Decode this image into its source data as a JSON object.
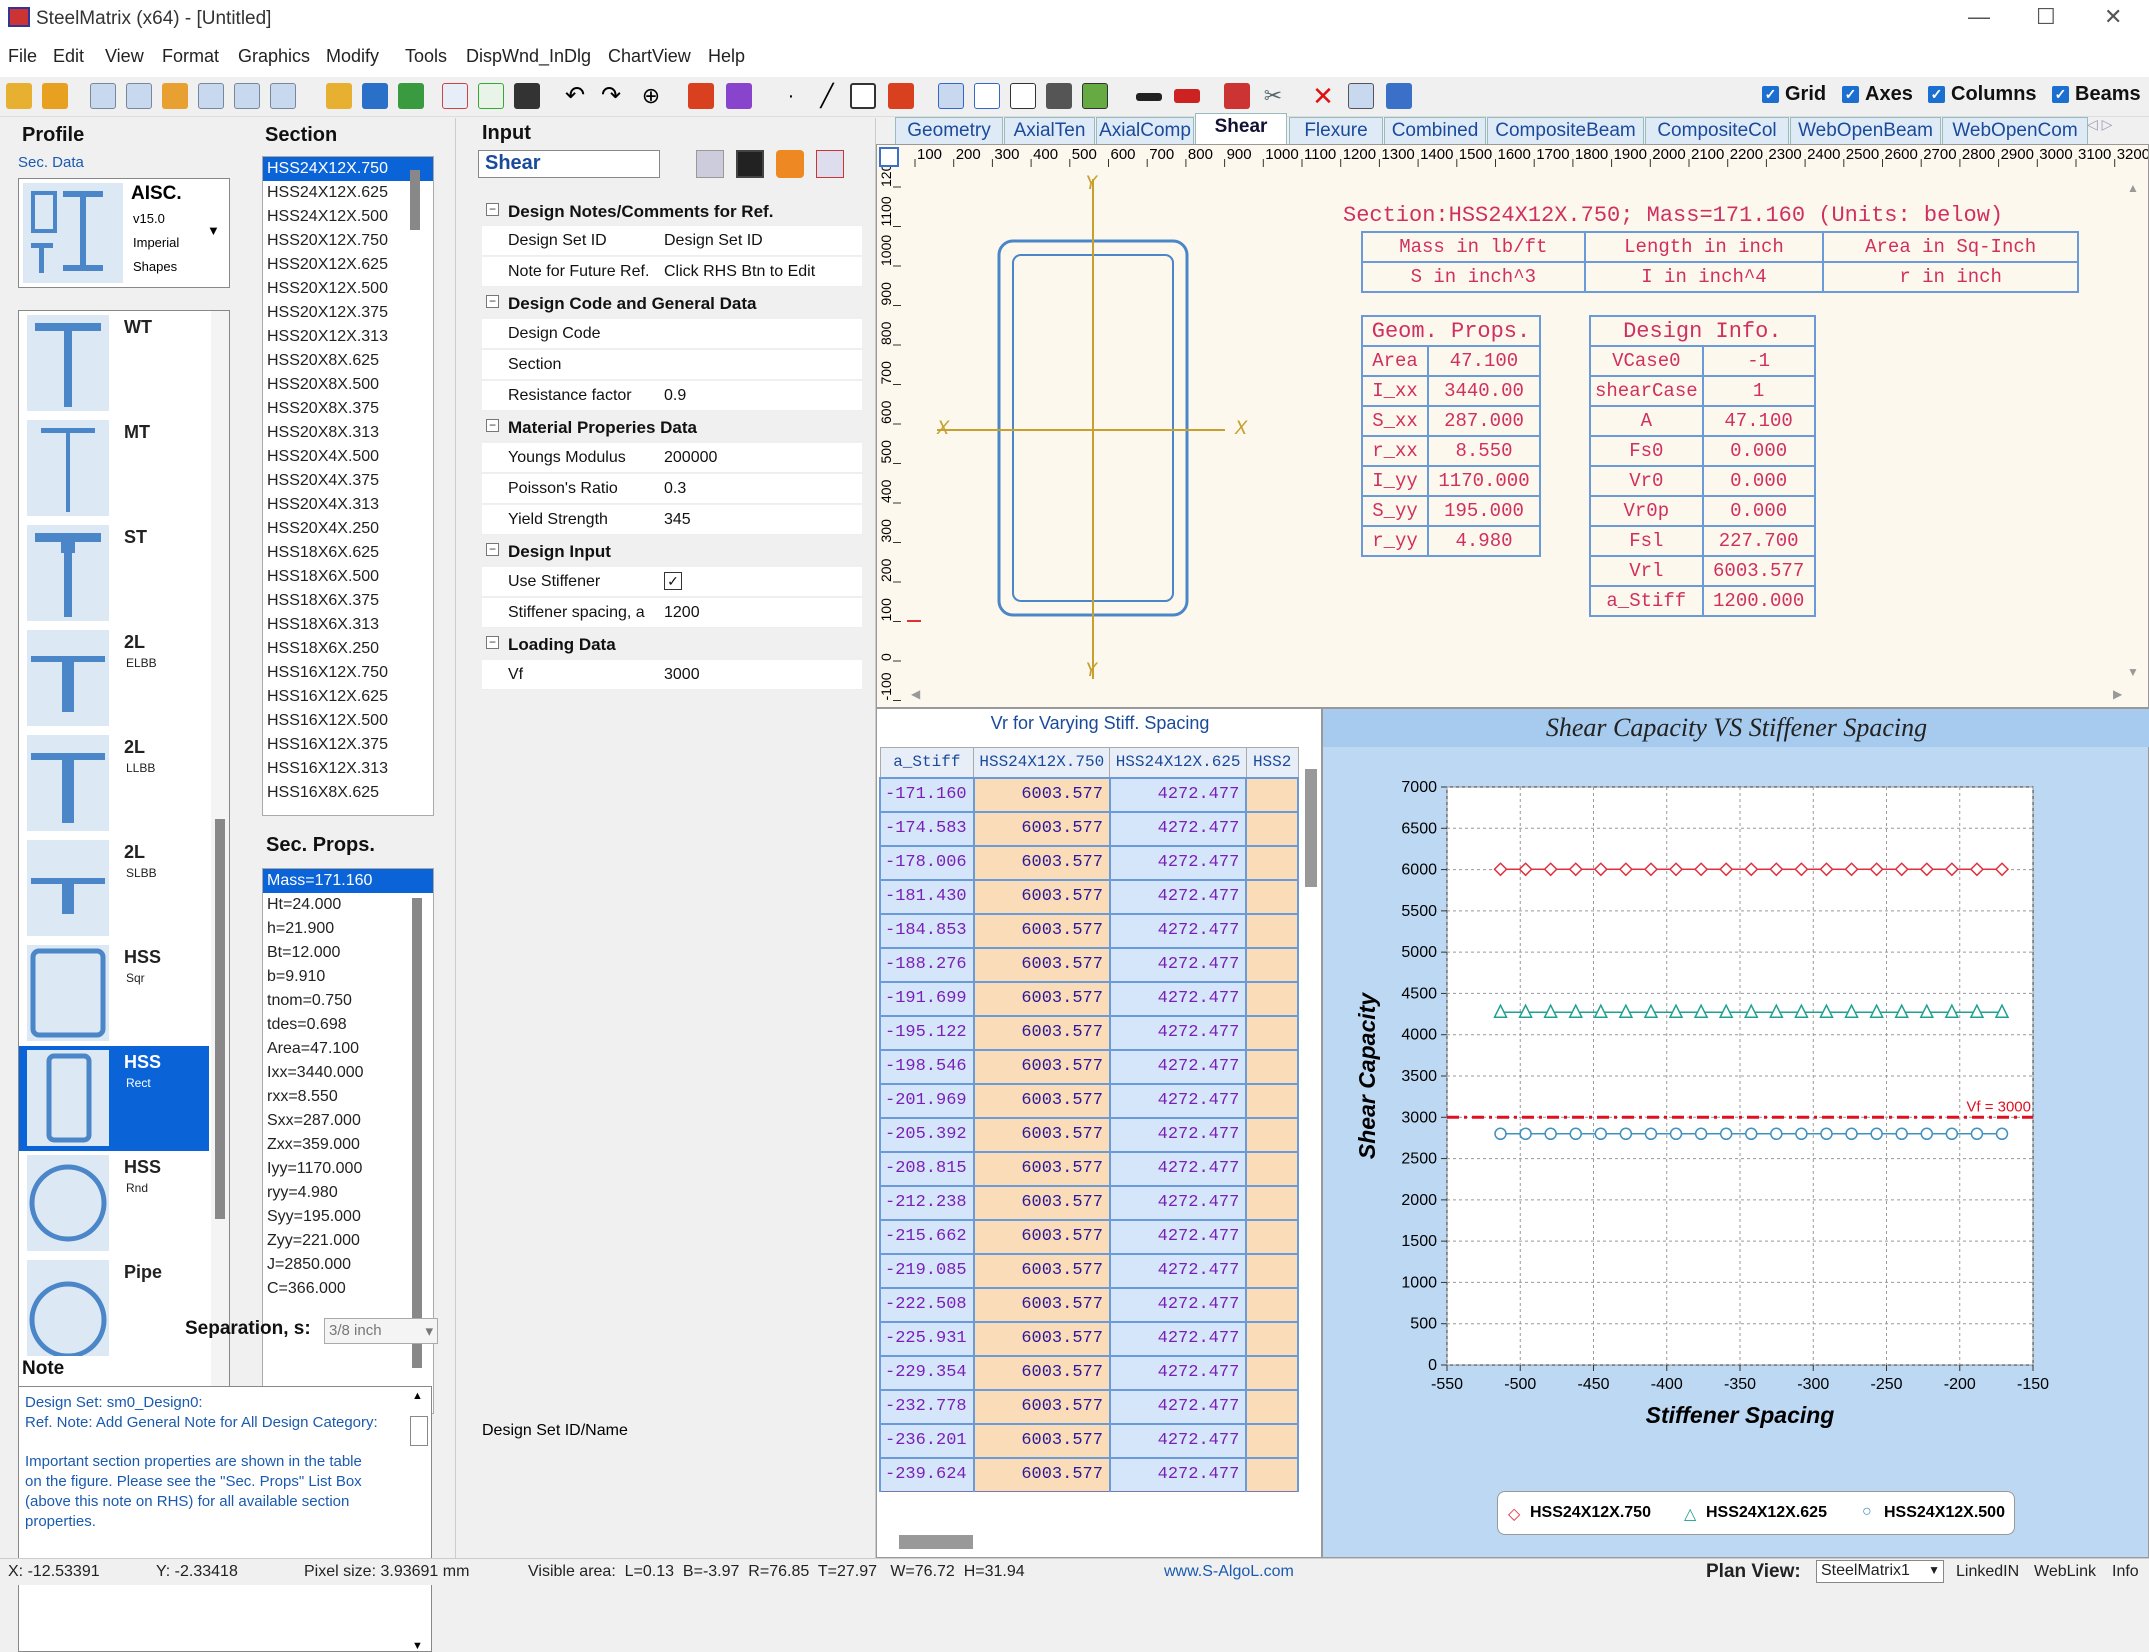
{
  "window": {
    "title": "SteelMatrix (x64) - [Untitled]"
  },
  "menu": [
    "File",
    "Edit",
    "View",
    "Format",
    "Graphics",
    "Modify",
    "Tools",
    "DispWnd_InDlg",
    "ChartView",
    "Help"
  ],
  "view_toggles": [
    {
      "label": "Grid",
      "checked": true
    },
    {
      "label": "Axes",
      "checked": true
    },
    {
      "label": "Columns",
      "checked": true
    },
    {
      "label": "Beams",
      "checked": true
    }
  ],
  "profile": {
    "title": "Profile",
    "sec_data": "Sec. Data",
    "db": {
      "name": "AISC.",
      "ver": "v15.0",
      "units": "Imperial",
      "desc": "Shapes"
    },
    "items": [
      {
        "name": "WT",
        "sub": ""
      },
      {
        "name": "MT",
        "sub": ""
      },
      {
        "name": "ST",
        "sub": ""
      },
      {
        "name": "2L",
        "sub": "ELBB"
      },
      {
        "name": "2L",
        "sub": "LLBB"
      },
      {
        "name": "2L",
        "sub": "SLBB"
      },
      {
        "name": "HSS",
        "sub": "Sqr"
      },
      {
        "name": "HSS",
        "sub": "Rect"
      },
      {
        "name": "HSS",
        "sub": "Rnd"
      },
      {
        "name": "Pipe",
        "sub": ""
      }
    ],
    "selected_index": 7
  },
  "section": {
    "title": "Section",
    "items": [
      "HSS24X12X.750",
      "HSS24X12X.625",
      "HSS24X12X.500",
      "HSS20X12X.750",
      "HSS20X12X.625",
      "HSS20X12X.500",
      "HSS20X12X.375",
      "HSS20X12X.313",
      "HSS20X8X.625",
      "HSS20X8X.500",
      "HSS20X8X.375",
      "HSS20X8X.313",
      "HSS20X4X.500",
      "HSS20X4X.375",
      "HSS20X4X.313",
      "HSS20X4X.250",
      "HSS18X6X.625",
      "HSS18X6X.500",
      "HSS18X6X.375",
      "HSS18X6X.313",
      "HSS18X6X.250",
      "HSS16X12X.750",
      "HSS16X12X.625",
      "HSS16X12X.500",
      "HSS16X12X.375",
      "HSS16X12X.313",
      "HSS16X8X.625"
    ],
    "selected_index": 0
  },
  "sec_props": {
    "title": "Sec. Props.",
    "items": [
      "Mass=171.160",
      "Ht=24.000",
      "h=21.900",
      "Bt=12.000",
      "b=9.910",
      "tnom=0.750",
      "tdes=0.698",
      "Area=47.100",
      "Ixx=3440.000",
      "rxx=8.550",
      "Sxx=287.000",
      "Zxx=359.000",
      "Iyy=1170.000",
      "ryy=4.980",
      "Syy=195.000",
      "Zyy=221.000",
      "J=2850.000",
      "C=366.000"
    ],
    "selected_index": 0
  },
  "separation": {
    "label": "Separation, s:",
    "value": "3/8 inch"
  },
  "note": {
    "title": "Note",
    "lines": [
      "Design Set: sm0_Design0:",
      "Ref. Note: Add General Note for All Design Category:",
      "",
      "Important section properties are shown in the table",
      "on the figure. Please see the \"Sec. Props\" List Box",
      "(above this note on RHS) for all available section",
      "properties."
    ]
  },
  "input": {
    "title": "Input",
    "category": "Shear",
    "rows": [
      {
        "type": "cat",
        "label": "Design Notes/Comments for Ref."
      },
      {
        "type": "row",
        "label": "Design Set ID",
        "value": "Design Set ID"
      },
      {
        "type": "row",
        "label": "Note for Future Ref.",
        "value": "Click RHS Btn to Edit"
      },
      {
        "type": "cat",
        "label": "Design Code and General Data"
      },
      {
        "type": "row",
        "label": "Design Code",
        "value": ""
      },
      {
        "type": "row",
        "label": "Section",
        "value": ""
      },
      {
        "type": "row",
        "label": "Resistance factor",
        "value": "0.9"
      },
      {
        "type": "cat",
        "label": "Material Properies Data"
      },
      {
        "type": "row",
        "label": "Youngs Modulus",
        "value": "200000"
      },
      {
        "type": "row",
        "label": "Poisson's Ratio",
        "value": "0.3"
      },
      {
        "type": "row",
        "label": "Yield Strength",
        "value": "345"
      },
      {
        "type": "cat",
        "label": "Design Input"
      },
      {
        "type": "row",
        "label": "Use Stiffener",
        "value": "✓"
      },
      {
        "type": "row",
        "label": "Stiffener spacing, a",
        "value": "1200"
      },
      {
        "type": "cat",
        "label": "Loading Data"
      },
      {
        "type": "row",
        "label": "Vf",
        "value": "3000"
      }
    ],
    "footer": "Design Set ID/Name"
  },
  "tabs": [
    "Geometry",
    "AxialTen",
    "AxialComp",
    "Shear",
    "Flexure",
    "Combined",
    "CompositeBeam",
    "CompositeCol",
    "WebOpenBeam",
    "WebOpenCom"
  ],
  "active_tab": "Shear",
  "ruler": {
    "x": [
      "100",
      "200",
      "300",
      "400",
      "500",
      "600",
      "700",
      "800",
      "900",
      "1000",
      "1100",
      "1200",
      "1300",
      "1400",
      "1500",
      "1600",
      "1700",
      "1800",
      "1900",
      "2000",
      "2100",
      "2200",
      "2300",
      "2400",
      "2500",
      "2600",
      "2700",
      "2800",
      "2900",
      "3000",
      "3100",
      "3200",
      "330"
    ],
    "y": [
      "1200",
      "1100",
      "1000",
      "900",
      "800",
      "700",
      "600",
      "500",
      "400",
      "300",
      "200",
      "100",
      "0",
      "-100"
    ]
  },
  "drawing": {
    "axis_labels": {
      "y_top": "Y",
      "y_bottom": "Y",
      "x_left": "X",
      "x_right": "X"
    },
    "header": "Section:HSS24X12X.750; Mass=171.160 (Units: below)",
    "units": [
      [
        "Mass in lb/ft",
        "Length in inch",
        "Area in Sq-Inch"
      ],
      [
        "S in inch^3",
        "I in inch^4",
        "r in inch"
      ]
    ],
    "geom_title": "Geom. Props.",
    "geom": [
      [
        "Area",
        "47.100"
      ],
      [
        "I_xx",
        "3440.00"
      ],
      [
        "S_xx",
        "287.000"
      ],
      [
        "r_xx",
        "8.550"
      ],
      [
        "I_yy",
        "1170.000"
      ],
      [
        "S_yy",
        "195.000"
      ],
      [
        "r_yy",
        "4.980"
      ]
    ],
    "design_title": "Design Info.",
    "design": [
      [
        "VCase0",
        "-1"
      ],
      [
        "shearCase",
        "1"
      ],
      [
        "A",
        "47.100"
      ],
      [
        "Fs0",
        "0.000"
      ],
      [
        "Vr0",
        "0.000"
      ],
      [
        "Vr0p",
        "0.000"
      ],
      [
        "Fsl",
        "227.700"
      ],
      [
        "Vrl",
        "6003.577"
      ],
      [
        "a_Stiff",
        "1200.000"
      ]
    ]
  },
  "grid_panel": {
    "title": "Vr for Varying Stiff. Spacing",
    "headers": [
      "a_Stiff",
      "HSS24X12X.750",
      "HSS24X12X.625",
      "HSS2"
    ],
    "rows": [
      [
        "-171.160",
        "6003.577",
        "4272.477"
      ],
      [
        "-174.583",
        "6003.577",
        "4272.477"
      ],
      [
        "-178.006",
        "6003.577",
        "4272.477"
      ],
      [
        "-181.430",
        "6003.577",
        "4272.477"
      ],
      [
        "-184.853",
        "6003.577",
        "4272.477"
      ],
      [
        "-188.276",
        "6003.577",
        "4272.477"
      ],
      [
        "-191.699",
        "6003.577",
        "4272.477"
      ],
      [
        "-195.122",
        "6003.577",
        "4272.477"
      ],
      [
        "-198.546",
        "6003.577",
        "4272.477"
      ],
      [
        "-201.969",
        "6003.577",
        "4272.477"
      ],
      [
        "-205.392",
        "6003.577",
        "4272.477"
      ],
      [
        "-208.815",
        "6003.577",
        "4272.477"
      ],
      [
        "-212.238",
        "6003.577",
        "4272.477"
      ],
      [
        "-215.662",
        "6003.577",
        "4272.477"
      ],
      [
        "-219.085",
        "6003.577",
        "4272.477"
      ],
      [
        "-222.508",
        "6003.577",
        "4272.477"
      ],
      [
        "-225.931",
        "6003.577",
        "4272.477"
      ],
      [
        "-229.354",
        "6003.577",
        "4272.477"
      ],
      [
        "-232.778",
        "6003.577",
        "4272.477"
      ],
      [
        "-236.201",
        "6003.577",
        "4272.477"
      ],
      [
        "-239.624",
        "6003.577",
        "4272.477"
      ]
    ]
  },
  "chart_data": {
    "type": "line",
    "title": "Shear Capacity VS Stiffener Spacing",
    "xlabel": "Stiffener Spacing",
    "ylabel": "Shear Capacity",
    "xlim": [
      -550,
      -150
    ],
    "ylim": [
      0,
      7000
    ],
    "xticks": [
      "-550",
      "-500",
      "-450",
      "-400",
      "-350",
      "-300",
      "-250",
      "-200",
      "-150"
    ],
    "yticks": [
      "0",
      "500",
      "1000",
      "1500",
      "2000",
      "2500",
      "3000",
      "3500",
      "4000",
      "4500",
      "5000",
      "5500",
      "6000",
      "6500",
      "7000"
    ],
    "x": [
      -513.48,
      -496.36,
      -479.25,
      -462.13,
      -445.02,
      -427.9,
      -410.78,
      -393.67,
      -376.55,
      -359.44,
      -342.32,
      -325.2,
      -308.09,
      -290.97,
      -273.86,
      -256.74,
      -239.62,
      -222.51,
      -205.39,
      -188.28,
      -171.16
    ],
    "series": [
      {
        "name": "HSS24X12X.750",
        "value": 6003.577,
        "color": "#e03040",
        "marker": "diamond"
      },
      {
        "name": "HSS24X12X.625",
        "value": 4272.477,
        "color": "#20a090",
        "marker": "triangle"
      },
      {
        "name": "HSS24X12X.500",
        "value": 2800,
        "color": "#4090c0",
        "marker": "circle"
      }
    ],
    "reference_line": {
      "label": "Vf = 3000",
      "value": 3000,
      "color": "#e01020"
    },
    "legend_position": "bottom"
  },
  "status": {
    "x": "X: -12.53391",
    "y": "Y: -2.33418",
    "pixel": "Pixel size: 3.93691 mm",
    "visible": "Visible area:  L=0.13  B=-3.97  R=76.85  T=27.97   W=76.72  H=31.94",
    "web": "www.S-AlgoL.com",
    "plan_label": "Plan View:",
    "plan_value": "SteelMatrix1",
    "btn1": "LinkedIN",
    "btn2": "WebLink",
    "btn3": "Info"
  }
}
